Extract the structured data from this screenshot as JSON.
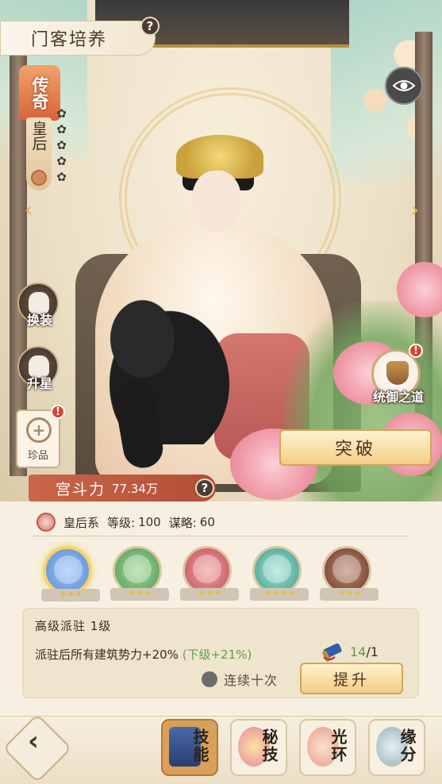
{
  "header": {
    "title": "门客培养",
    "help_label": "?"
  },
  "character": {
    "rarity": "传奇",
    "title": "皇后",
    "petal_icons": [
      "✿",
      "✿",
      "✿",
      "✿",
      "✿"
    ]
  },
  "nav": {
    "prev_arrow": "‹",
    "next_arrow": "›"
  },
  "side_menu": {
    "change_outfit": "换装",
    "star_up": "升星",
    "treasure": "珍品",
    "treasure_badge": "!",
    "treasure_glyph": "+"
  },
  "right_menu": {
    "command_way": "统御之道",
    "command_badge": "!",
    "breakthrough": "突破"
  },
  "power": {
    "label": "宫斗力",
    "value": "77.34万",
    "help_label": "?"
  },
  "attributes": {
    "faction": "皇后系",
    "level_label": "等级:",
    "level_value": "100",
    "strategy_label": "谋略:",
    "strategy_value": "60"
  },
  "skills": [
    {
      "id": "skill-1",
      "selected": true,
      "color": "#5b8bd6",
      "stars": "✦✦✦"
    },
    {
      "id": "skill-2",
      "selected": false,
      "color": "#4d9a52",
      "stars": "✦✦✦"
    },
    {
      "id": "skill-3",
      "selected": false,
      "color": "#c2505a",
      "stars": "✦✦✦"
    },
    {
      "id": "skill-4",
      "selected": false,
      "color": "#3f9c8a",
      "stars": "✦✦✦✦"
    },
    {
      "id": "skill-5",
      "selected": false,
      "color": "#6a3a2c",
      "stars": "✦✦✦"
    }
  ],
  "skill_detail": {
    "title": "高级派驻 1级",
    "description": "派驻后所有建筑势力+20%",
    "next_level": "(下级+21%)",
    "item_have": "14",
    "item_need": "/1",
    "continuous_label": "连续十次",
    "upgrade_label": "提升"
  },
  "bottom_tabs": [
    {
      "id": "skills",
      "label": "技能",
      "active": true
    },
    {
      "id": "secret",
      "label": "秘技",
      "active": false
    },
    {
      "id": "aura",
      "label": "光环",
      "active": false
    },
    {
      "id": "fate",
      "label": "缘分",
      "active": false
    }
  ],
  "back_label": "‹",
  "colors": {
    "accent_gold": "#f2cf86",
    "power_red": "#b24e36",
    "green_text": "#5ea04a"
  }
}
